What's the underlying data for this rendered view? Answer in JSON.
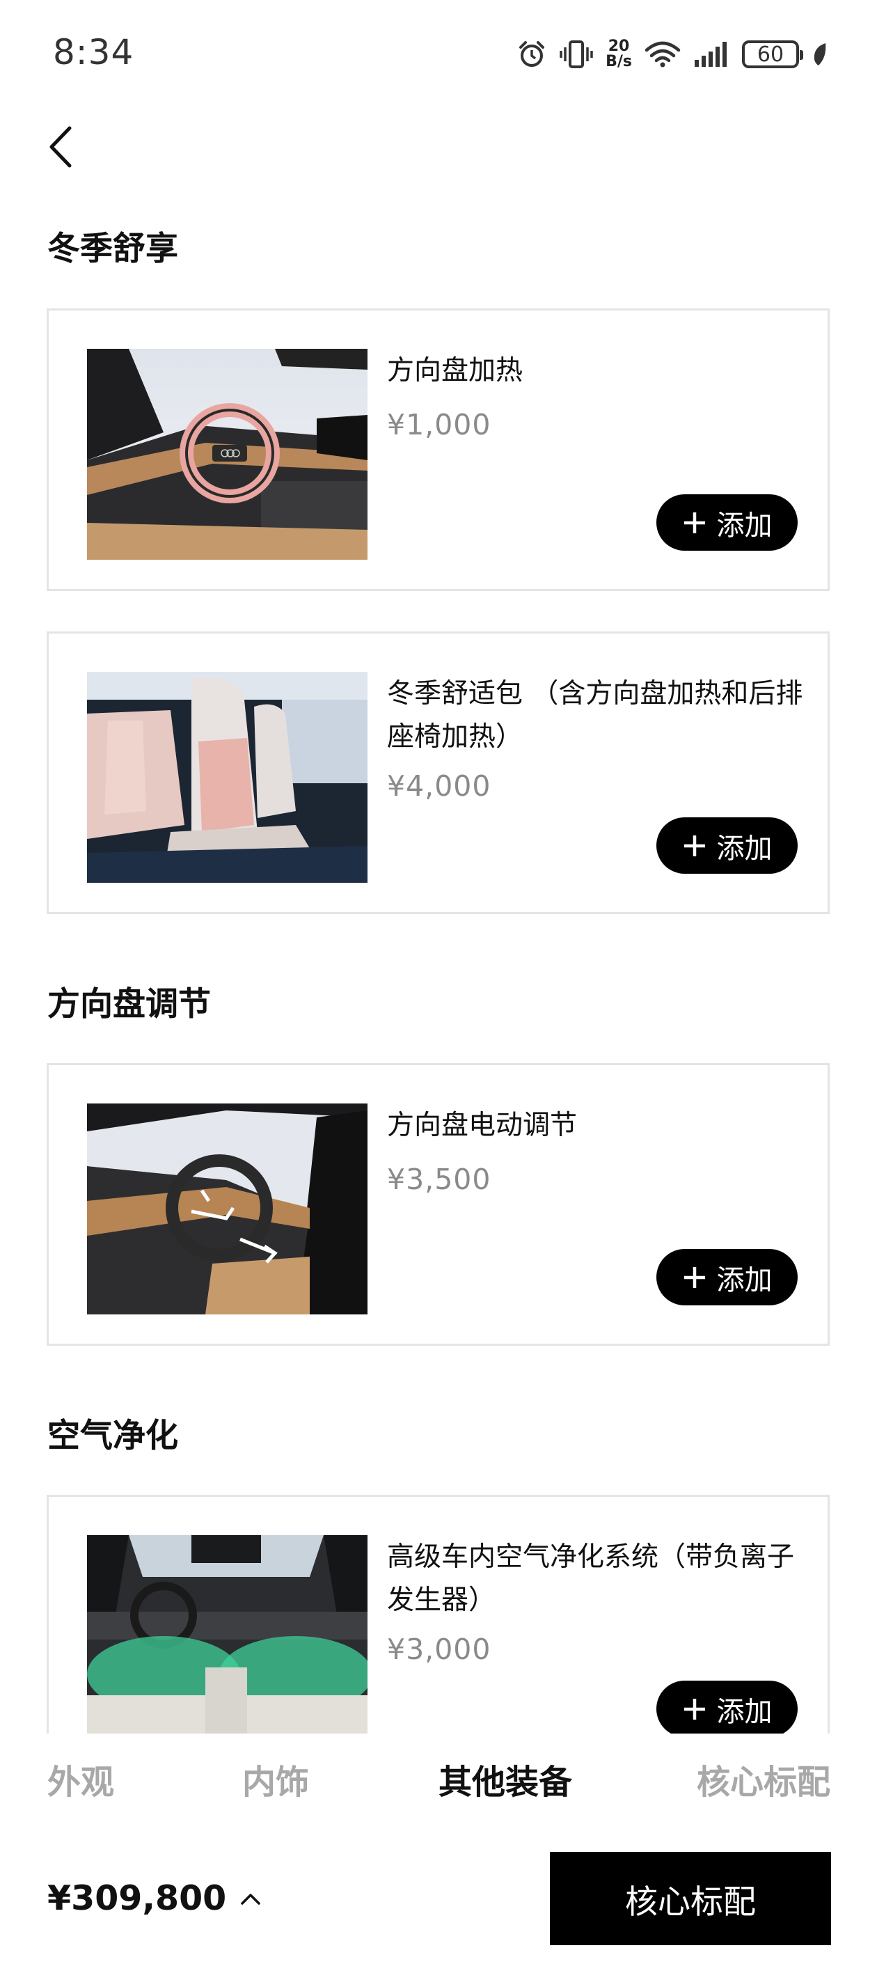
{
  "status_bar": {
    "time": "8:34",
    "net_speed_value": "20",
    "net_speed_unit": "B/s",
    "battery": "60",
    "icons": [
      "alarm-icon",
      "vibrate-icon",
      "wifi-icon",
      "signal-icon",
      "battery-icon",
      "leaf-icon"
    ]
  },
  "nav": {
    "back_icon": "chevron-left-icon"
  },
  "sections": [
    {
      "title": "冬季舒享",
      "items": [
        {
          "title": "方向盘加热",
          "price": "¥1,000",
          "add_label": "添加",
          "image": "heated-steering-wheel-photo"
        },
        {
          "title": "冬季舒适包 （含方向盘加热和后排座椅加热）",
          "price": "¥4,000",
          "add_label": "添加",
          "image": "heated-seats-photo"
        }
      ]
    },
    {
      "title": "方向盘调节",
      "items": [
        {
          "title": "方向盘电动调节",
          "price": "¥3,500",
          "add_label": "添加",
          "image": "electric-steering-adjust-photo"
        }
      ]
    },
    {
      "title": "空气净化",
      "items": [
        {
          "title": "高级车内空气净化系统（带负离子发生器）",
          "price": "¥3,000",
          "add_label": "添加",
          "image": "air-purifier-photo"
        }
      ]
    }
  ],
  "tabs": [
    {
      "label": "外观",
      "active": false
    },
    {
      "label": "内饰",
      "active": false
    },
    {
      "label": "其他装备",
      "active": true
    },
    {
      "label": "核心标配",
      "active": false
    }
  ],
  "footer": {
    "total_price": "¥309,800",
    "expand_icon": "chevron-up-icon",
    "core_button_label": "核心标配"
  },
  "colors": {
    "button_bg": "#000000",
    "price_gray": "#8a8a8a",
    "tab_inactive": "#a8a8a8",
    "card_border": "#e4e4e4"
  }
}
